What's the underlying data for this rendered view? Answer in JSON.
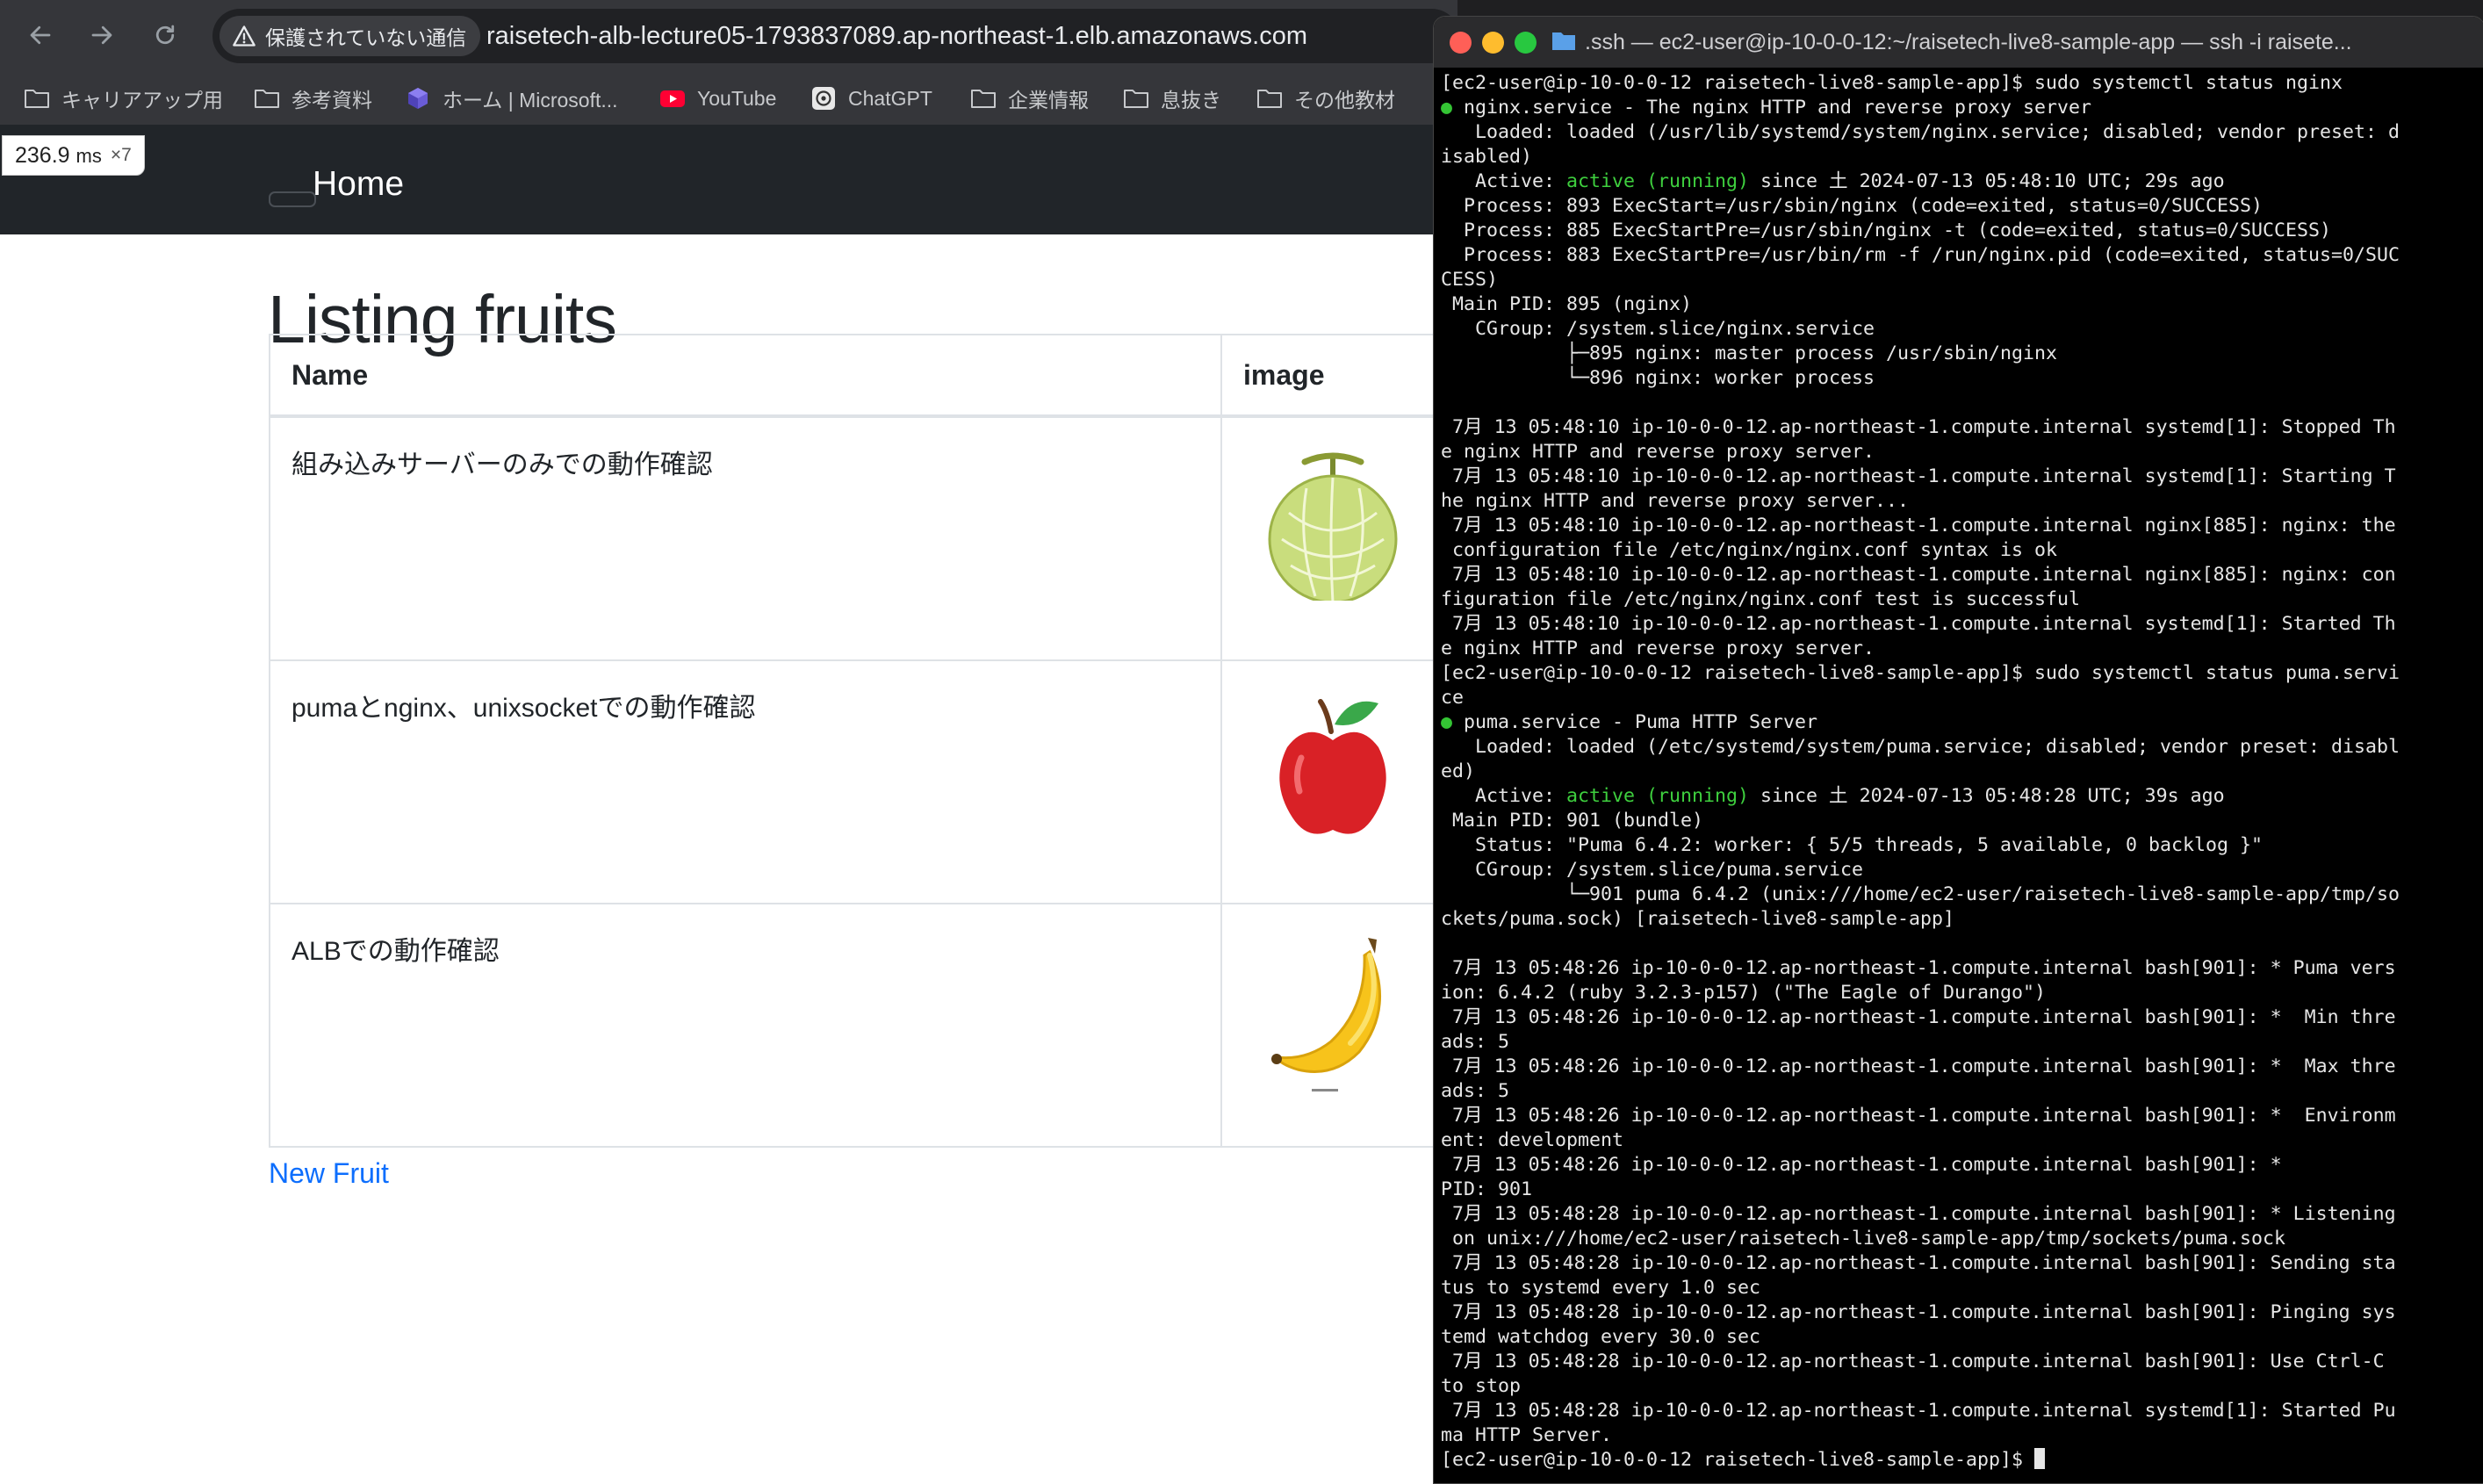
{
  "browser": {
    "security_label": "保護されていない通信",
    "url": "raisetech-alb-lecture05-1793837089.ap-northeast-1.elb.amazonaws.com",
    "bookmarks": [
      "キャリアアップ用",
      "参考資料",
      "ホーム | Microsoft...",
      "YouTube",
      "ChatGPT",
      "企業情報",
      "息抜き",
      "その他教材"
    ],
    "perf_badge": {
      "value": "236.9",
      "unit": "ms",
      "multiplier": "×7"
    }
  },
  "page": {
    "brand": "Home",
    "title": "Listing fruits",
    "table": {
      "headers": [
        "Name",
        "image"
      ],
      "rows": [
        {
          "name": "組み込みサーバーのみでの動作確認",
          "image": "melon"
        },
        {
          "name": "pumaとnginx、unixsocketでの動作確認",
          "image": "apple"
        },
        {
          "name": "ALBでの動作確認",
          "image": "banana"
        }
      ]
    },
    "new_link": "New Fruit"
  },
  "terminal": {
    "title": ".ssh — ec2-user@ip-10-0-0-12:~/raisetech-live8-sample-app — ssh -i raisete...",
    "lines": [
      "[ec2-user@ip-10-0-0-12 raisetech-live8-sample-app]$ sudo systemctl status nginx",
      "● nginx.service - The nginx HTTP and reverse proxy server",
      "   Loaded: loaded (/usr/lib/systemd/system/nginx.service; disabled; vendor preset: d",
      "isabled)",
      "   Active: active (running) since 土 2024-07-13 05:48:10 UTC; 29s ago",
      "  Process: 893 ExecStart=/usr/sbin/nginx (code=exited, status=0/SUCCESS)",
      "  Process: 885 ExecStartPre=/usr/sbin/nginx -t (code=exited, status=0/SUCCESS)",
      "  Process: 883 ExecStartPre=/usr/bin/rm -f /run/nginx.pid (code=exited, status=0/SUC",
      "CESS)",
      " Main PID: 895 (nginx)",
      "   CGroup: /system.slice/nginx.service",
      "           ├─895 nginx: master process /usr/sbin/nginx",
      "           └─896 nginx: worker process",
      "",
      " 7月 13 05:48:10 ip-10-0-0-12.ap-northeast-1.compute.internal systemd[1]: Stopped Th",
      "e nginx HTTP and reverse proxy server.",
      " 7月 13 05:48:10 ip-10-0-0-12.ap-northeast-1.compute.internal systemd[1]: Starting T",
      "he nginx HTTP and reverse proxy server...",
      " 7月 13 05:48:10 ip-10-0-0-12.ap-northeast-1.compute.internal nginx[885]: nginx: the",
      " configuration file /etc/nginx/nginx.conf syntax is ok",
      " 7月 13 05:48:10 ip-10-0-0-12.ap-northeast-1.compute.internal nginx[885]: nginx: con",
      "figuration file /etc/nginx/nginx.conf test is successful",
      " 7月 13 05:48:10 ip-10-0-0-12.ap-northeast-1.compute.internal systemd[1]: Started Th",
      "e nginx HTTP and reverse proxy server.",
      "[ec2-user@ip-10-0-0-12 raisetech-live8-sample-app]$ sudo systemctl status puma.servi",
      "ce",
      "● puma.service - Puma HTTP Server",
      "   Loaded: loaded (/etc/systemd/system/puma.service; disabled; vendor preset: disabl",
      "ed)",
      "   Active: active (running) since 土 2024-07-13 05:48:28 UTC; 39s ago",
      " Main PID: 901 (bundle)",
      "   Status: \"Puma 6.4.2: worker: { 5/5 threads, 5 available, 0 backlog }\"",
      "   CGroup: /system.slice/puma.service",
      "           └─901 puma 6.4.2 (unix:///home/ec2-user/raisetech-live8-sample-app/tmp/so",
      "ckets/puma.sock) [raisetech-live8-sample-app]",
      "",
      " 7月 13 05:48:26 ip-10-0-0-12.ap-northeast-1.compute.internal bash[901]: * Puma vers",
      "ion: 6.4.2 (ruby 3.2.3-p157) (\"The Eagle of Durango\")",
      " 7月 13 05:48:26 ip-10-0-0-12.ap-northeast-1.compute.internal bash[901]: *  Min thre",
      "ads: 5",
      " 7月 13 05:48:26 ip-10-0-0-12.ap-northeast-1.compute.internal bash[901]: *  Max thre",
      "ads: 5",
      " 7月 13 05:48:26 ip-10-0-0-12.ap-northeast-1.compute.internal bash[901]: *  Environm",
      "ent: development",
      " 7月 13 05:48:26 ip-10-0-0-12.ap-northeast-1.compute.internal bash[901]: *",
      "PID: 901",
      " 7月 13 05:48:28 ip-10-0-0-12.ap-northeast-1.compute.internal bash[901]: * Listening",
      " on unix:///home/ec2-user/raisetech-live8-sample-app/tmp/sockets/puma.sock",
      " 7月 13 05:48:28 ip-10-0-0-12.ap-northeast-1.compute.internal bash[901]: Sending sta",
      "tus to systemd every 1.0 sec",
      " 7月 13 05:48:28 ip-10-0-0-12.ap-northeast-1.compute.internal bash[901]: Pinging sys",
      "temd watchdog every 30.0 sec",
      " 7月 13 05:48:28 ip-10-0-0-12.ap-northeast-1.compute.internal bash[901]: Use Ctrl-C",
      "to stop",
      " 7月 13 05:48:28 ip-10-0-0-12.ap-northeast-1.compute.internal systemd[1]: Started Pu",
      "ma HTTP Server.",
      "[ec2-user@ip-10-0-0-12 raisetech-live8-sample-app]$ "
    ],
    "colors": {
      "active": "#3ecf3e",
      "background": "#000000",
      "text": "#e6e6e6"
    }
  }
}
